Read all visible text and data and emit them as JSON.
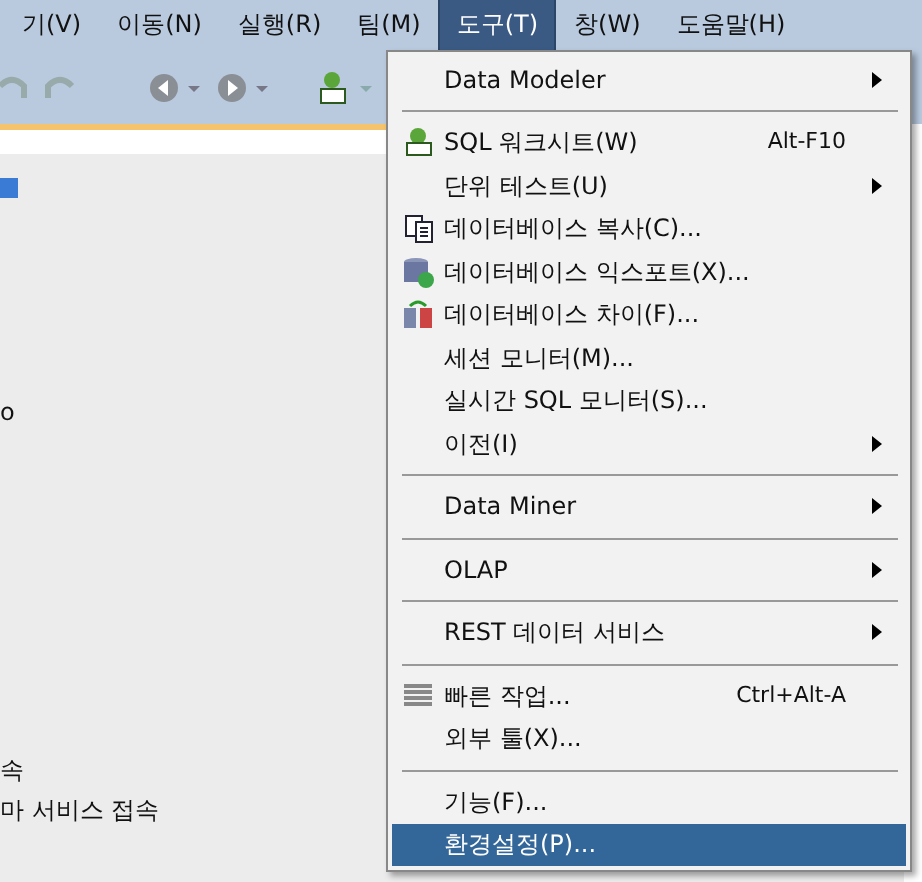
{
  "menubar": [
    {
      "label": "기(V)",
      "selected": false
    },
    {
      "label": "이동(N)",
      "selected": false
    },
    {
      "label": "실행(R)",
      "selected": false
    },
    {
      "label": "팀(M)",
      "selected": false
    },
    {
      "label": "도구(T)",
      "selected": true
    },
    {
      "label": "창(W)",
      "selected": false
    },
    {
      "label": "도움말(H)",
      "selected": false
    }
  ],
  "left_panel": {
    "lines": [
      "o",
      "속",
      "마 서비스 접속"
    ]
  },
  "menu": [
    {
      "kind": "item",
      "label": "Data Modeler",
      "submenu": true,
      "selected": false
    },
    {
      "kind": "separator"
    },
    {
      "kind": "item",
      "label": "SQL 워크시트(W)",
      "shortcut": "Alt-F10",
      "selected": false
    },
    {
      "kind": "item",
      "label": "단위 테스트(U)",
      "submenu": true,
      "selected": false
    },
    {
      "kind": "item",
      "label": "데이터베이스 복사(C)...",
      "selected": false
    },
    {
      "kind": "item",
      "label": "데이터베이스 익스포트(X)...",
      "selected": false
    },
    {
      "kind": "item",
      "label": "데이터베이스 차이(F)...",
      "selected": false
    },
    {
      "kind": "item",
      "label": "세션 모니터(M)...",
      "selected": false
    },
    {
      "kind": "item",
      "label": "실시간 SQL 모니터(S)...",
      "selected": false
    },
    {
      "kind": "item",
      "label": "이전(I)",
      "submenu": true,
      "selected": false
    },
    {
      "kind": "separator"
    },
    {
      "kind": "item",
      "label": "Data Miner",
      "submenu": true,
      "selected": false
    },
    {
      "kind": "separator"
    },
    {
      "kind": "item",
      "label": "OLAP",
      "submenu": true,
      "selected": false
    },
    {
      "kind": "separator"
    },
    {
      "kind": "item",
      "label": "REST 데이터 서비스",
      "submenu": true,
      "selected": false
    },
    {
      "kind": "separator"
    },
    {
      "kind": "item",
      "label": "빠른 작업...",
      "shortcut": "Ctrl+Alt-A",
      "selected": false
    },
    {
      "kind": "item",
      "label": "외부 툴(X)...",
      "selected": false
    },
    {
      "kind": "separator"
    },
    {
      "kind": "item",
      "label": "기능(F)...",
      "selected": false
    },
    {
      "kind": "item",
      "label": "환경설정(P)...",
      "selected": true
    }
  ]
}
